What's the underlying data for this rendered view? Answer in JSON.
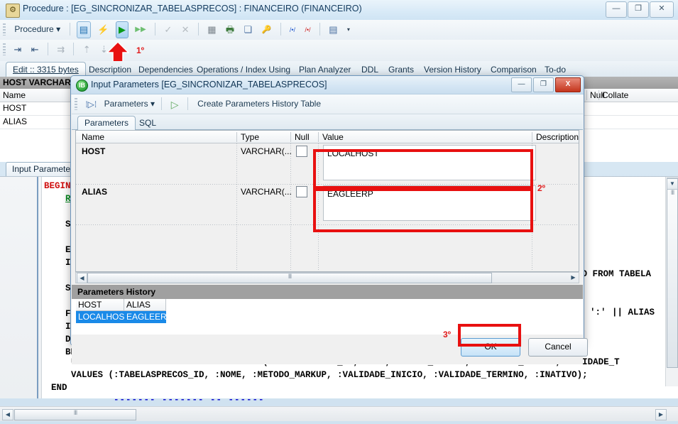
{
  "main_window": {
    "title": "Procedure : [EG_SINCRONIZAR_TABELASPRECOS] : FINANCEIRO (FINANCEIRO)",
    "app_icon": "procedure-icon",
    "controls": {
      "minimize": "—",
      "maximize": "❐",
      "close": "✕"
    }
  },
  "toolbar": {
    "menu_label": "Procedure",
    "menu_caret": "▾",
    "object_name": "EG_SINCRONIZAR_TABELASPRECOS",
    "combo_arrow": "▾",
    "overflow_arrow": "▾",
    "buttons": [
      {
        "name": "view-object-icon",
        "glyph": "▤"
      },
      {
        "name": "compile-icon",
        "glyph": "⚡"
      },
      {
        "name": "execute-icon",
        "glyph": "▶"
      },
      {
        "name": "execute-step-icon",
        "glyph": "▶▶"
      },
      {
        "name": "commit-icon",
        "glyph": "✓"
      },
      {
        "name": "rollback-icon",
        "glyph": "✕"
      },
      {
        "name": "grid-icon",
        "glyph": "▦"
      },
      {
        "name": "print-icon",
        "glyph": "🖶"
      },
      {
        "name": "copy-object-icon",
        "glyph": "❏"
      },
      {
        "name": "grant-key-icon",
        "glyph": "🔑"
      },
      {
        "name": "prev-diff-icon",
        "glyph": "/•/"
      },
      {
        "name": "next-diff-icon",
        "glyph": "/•/"
      },
      {
        "name": "layout-icon",
        "glyph": "▤"
      }
    ],
    "row2_buttons": [
      {
        "name": "indent-block-icon",
        "glyph": "⇥"
      },
      {
        "name": "outdent-block-icon",
        "glyph": "⇤"
      },
      {
        "name": "comment-icon",
        "glyph": "⇉"
      },
      {
        "name": "bookmark-up-icon",
        "glyph": "⇡"
      },
      {
        "name": "bookmark-down-icon",
        "glyph": "⇣"
      }
    ]
  },
  "annotations": {
    "step1": "1º",
    "step2": "2º",
    "step3": "3º",
    "arrow": "up-arrow-annotation"
  },
  "tabs": [
    {
      "label": "Edit :: 3315 bytes",
      "active": true
    },
    {
      "label": "Description",
      "active": false
    },
    {
      "label": "Dependencies",
      "active": false
    },
    {
      "label": "Operations / Index Using",
      "active": false
    },
    {
      "label": "Plan Analyzer",
      "active": false
    },
    {
      "label": "DDL",
      "active": false
    },
    {
      "label": "Grants",
      "active": false
    },
    {
      "label": "Version History",
      "active": false
    },
    {
      "label": "Comparison",
      "active": false
    },
    {
      "label": "To-do",
      "active": false
    }
  ],
  "background_grid": {
    "group_header": "HOST VARCHAR",
    "columns": [
      "Name",
      "Null",
      "Collate"
    ],
    "rows": [
      {
        "name": "HOST"
      },
      {
        "name": "ALIAS"
      }
    ],
    "lower_tab": "Input Parameters"
  },
  "editor": {
    "lines": [
      "BEGIN",
      "    RDB",
      "",
      "    STM",
      "",
      "    EXE",
      "    INT",
      "",
      "    STM",
      "",
      "    FOR",
      "    INT",
      "    DO",
      "    BEG"
    ],
    "visible_right_fragment_1": "VO FROM TABELA",
    "visible_right_fragment_2": "':' || ALIAS",
    "sql_line_update": "UPDATE OR INSERT INTO TABELASPRECOS (TABELASPRECOS_ID, NOME, METODO_MARKUP, VALIDADE_INICIO, VALIDADE_T",
    "sql_line_values": "VALUES (:TABELASPRECOS_ID, :NOME, :METODO_MARKUP, :VALIDADE_INICIO, :VALIDADE_TERMINO, :INATIVO);",
    "sql_line_end": "END"
  },
  "dialog": {
    "title": "Input Parameters [EG_SINCRONIZAR_TABELASPRECOS]",
    "icon": "ib-logo-icon",
    "controls": {
      "minimize": "—",
      "maximize": "❐",
      "close": "X"
    },
    "toolbar": {
      "params_button": "Parameters",
      "params_caret": "▾",
      "run_icon": "▷",
      "create_history_label": "Create Parameters History Table"
    },
    "tabs": [
      {
        "label": "Parameters",
        "active": true
      },
      {
        "label": "SQL",
        "active": false
      }
    ],
    "grid": {
      "columns": [
        "Name",
        "Type",
        "Null",
        "Value",
        "Description"
      ],
      "rows": [
        {
          "name": "HOST",
          "type": "VARCHAR(...",
          "null": false,
          "value": "LOCALHOST",
          "description": ""
        },
        {
          "name": "ALIAS",
          "type": "VARCHAR(...",
          "null": false,
          "value": "EAGLEERP",
          "description": ""
        }
      ]
    },
    "history": {
      "title": "Parameters History",
      "columns": [
        "HOST",
        "ALIAS"
      ],
      "rows": [
        {
          "HOST": "LOCALHOST",
          "ALIAS": "EAGLEERP"
        }
      ]
    },
    "footer": {
      "ok_label": "OK",
      "cancel_label": "Cancel"
    }
  },
  "colors": {
    "annotation_red": "#e81010",
    "keyword_red": "#d01010",
    "identifier_green": "#0a8a22",
    "selection_cyan": "#00e5e5",
    "selection_blue": "#1a8ae8"
  }
}
